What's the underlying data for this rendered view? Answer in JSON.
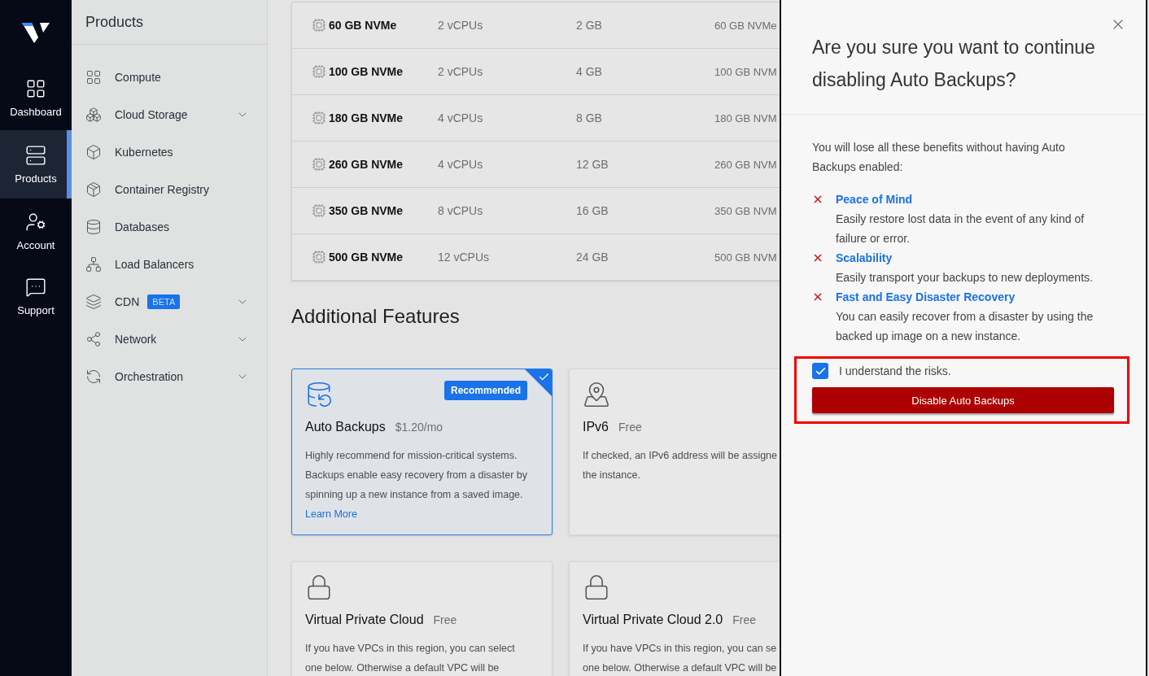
{
  "nav": {
    "items": [
      {
        "label": "Dashboard",
        "kind": "dashboard",
        "selected": false
      },
      {
        "label": "Products",
        "kind": "products",
        "selected": true
      },
      {
        "label": "Account",
        "kind": "account",
        "selected": false
      },
      {
        "label": "Support",
        "kind": "support",
        "selected": false
      }
    ]
  },
  "products_panel": {
    "title": "Products",
    "items": [
      {
        "label": "Compute",
        "kind": "compute",
        "expandable": false
      },
      {
        "label": "Cloud Storage",
        "kind": "storage",
        "expandable": true
      },
      {
        "label": "Kubernetes",
        "kind": "kubernetes",
        "expandable": false
      },
      {
        "label": "Container Registry",
        "kind": "registry",
        "expandable": false
      },
      {
        "label": "Databases",
        "kind": "databases",
        "expandable": false
      },
      {
        "label": "Load Balancers",
        "kind": "balancers",
        "expandable": false
      },
      {
        "label": "CDN",
        "kind": "cdn",
        "badge": "BETA",
        "expandable": true
      },
      {
        "label": "Network",
        "kind": "network",
        "expandable": true
      },
      {
        "label": "Orchestration",
        "kind": "orchestration",
        "expandable": true
      }
    ]
  },
  "plans": {
    "rows": [
      {
        "name": "60 GB NVMe",
        "cpu": "2 vCPUs",
        "ram": "2 GB",
        "storage": "60 GB NVMe"
      },
      {
        "name": "100 GB NVMe",
        "cpu": "2 vCPUs",
        "ram": "4 GB",
        "storage": "100 GB NVM"
      },
      {
        "name": "180 GB NVMe",
        "cpu": "4 vCPUs",
        "ram": "8 GB",
        "storage": "180 GB NVM"
      },
      {
        "name": "260 GB NVMe",
        "cpu": "4 vCPUs",
        "ram": "12 GB",
        "storage": "260 GB NVM"
      },
      {
        "name": "350 GB NVMe",
        "cpu": "8 vCPUs",
        "ram": "16 GB",
        "storage": "350 GB NVM"
      },
      {
        "name": "500 GB NVMe",
        "cpu": "12 vCPUs",
        "ram": "24 GB",
        "storage": "500 GB NVM"
      }
    ]
  },
  "features": {
    "title": "Additional Features",
    "cards": [
      {
        "kind": "backup",
        "title": "Auto Backups",
        "price": "$1.20/mo",
        "badge": "Recommended",
        "selected": true,
        "description": [
          "Highly recommend for mission-critical systems.",
          "Backups enable easy recovery from a disaster by",
          "spinning up a new instance from a saved image."
        ],
        "link": "Learn More"
      },
      {
        "kind": "ipv6",
        "title": "IPv6",
        "price": "Free",
        "selected": false,
        "description": [
          "If checked, an IPv6 address will be assigne",
          "the instance."
        ]
      },
      {
        "kind": "vpc",
        "title": "Virtual Private Cloud",
        "price": "Free",
        "selected": false,
        "description": [
          "If you have VPCs in this region, you can select",
          "one below. Otherwise a default VPC will be"
        ]
      },
      {
        "kind": "vpc",
        "title": "Virtual Private Cloud 2.0",
        "price": "Free",
        "selected": false,
        "description": [
          "If you have VPCs in this region, you can se",
          "one below. Otherwise a default VPC will be"
        ]
      }
    ]
  },
  "drawer": {
    "title": "Are you sure you want to continue disabling Auto Backups?",
    "intro": "You will lose all these benefits without having Auto Backups enabled:",
    "benefits": [
      {
        "title": "Peace of Mind",
        "text": "Easily restore lost data in the event of any kind of failure or error."
      },
      {
        "title": "Scalability",
        "text": "Easily transport your backups to new deployments."
      },
      {
        "title": "Fast and Easy Disaster Recovery",
        "text": "You can easily recover from a disaster by using the backed up image on a new instance."
      }
    ],
    "confirm": {
      "label": "I understand the risks.",
      "checked": true
    },
    "button": "Disable Auto Backups"
  }
}
